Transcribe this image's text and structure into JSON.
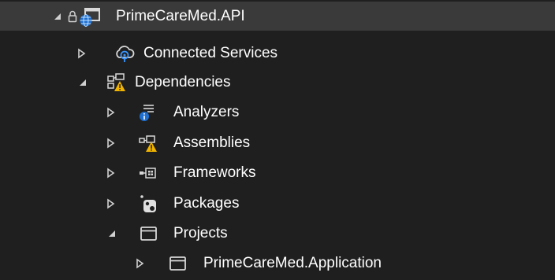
{
  "tree": {
    "items": [
      {
        "label": "PrimeCareMed.API",
        "icon": "web-project-icon",
        "expanded": true,
        "selected": true,
        "locked": true
      },
      {
        "label": "Connected Services",
        "icon": "connected-services-icon",
        "expanded": false
      },
      {
        "label": "Dependencies",
        "icon": "dependencies-warning-icon",
        "expanded": true
      },
      {
        "label": "Analyzers",
        "icon": "analyzers-icon",
        "expanded": false
      },
      {
        "label": "Assemblies",
        "icon": "assemblies-warning-icon",
        "expanded": false
      },
      {
        "label": "Frameworks",
        "icon": "frameworks-icon",
        "expanded": false
      },
      {
        "label": "Packages",
        "icon": "packages-icon",
        "expanded": false
      },
      {
        "label": "Projects",
        "icon": "projects-icon",
        "expanded": true
      },
      {
        "label": "PrimeCareMed.Application",
        "icon": "project-reference-icon",
        "expanded": false
      }
    ]
  },
  "colors": {
    "background": "#1f1f1f",
    "selected_row": "#3a3a3a",
    "text": "#ffffff",
    "warning": "#f0b400",
    "info_blue": "#3794ff"
  }
}
